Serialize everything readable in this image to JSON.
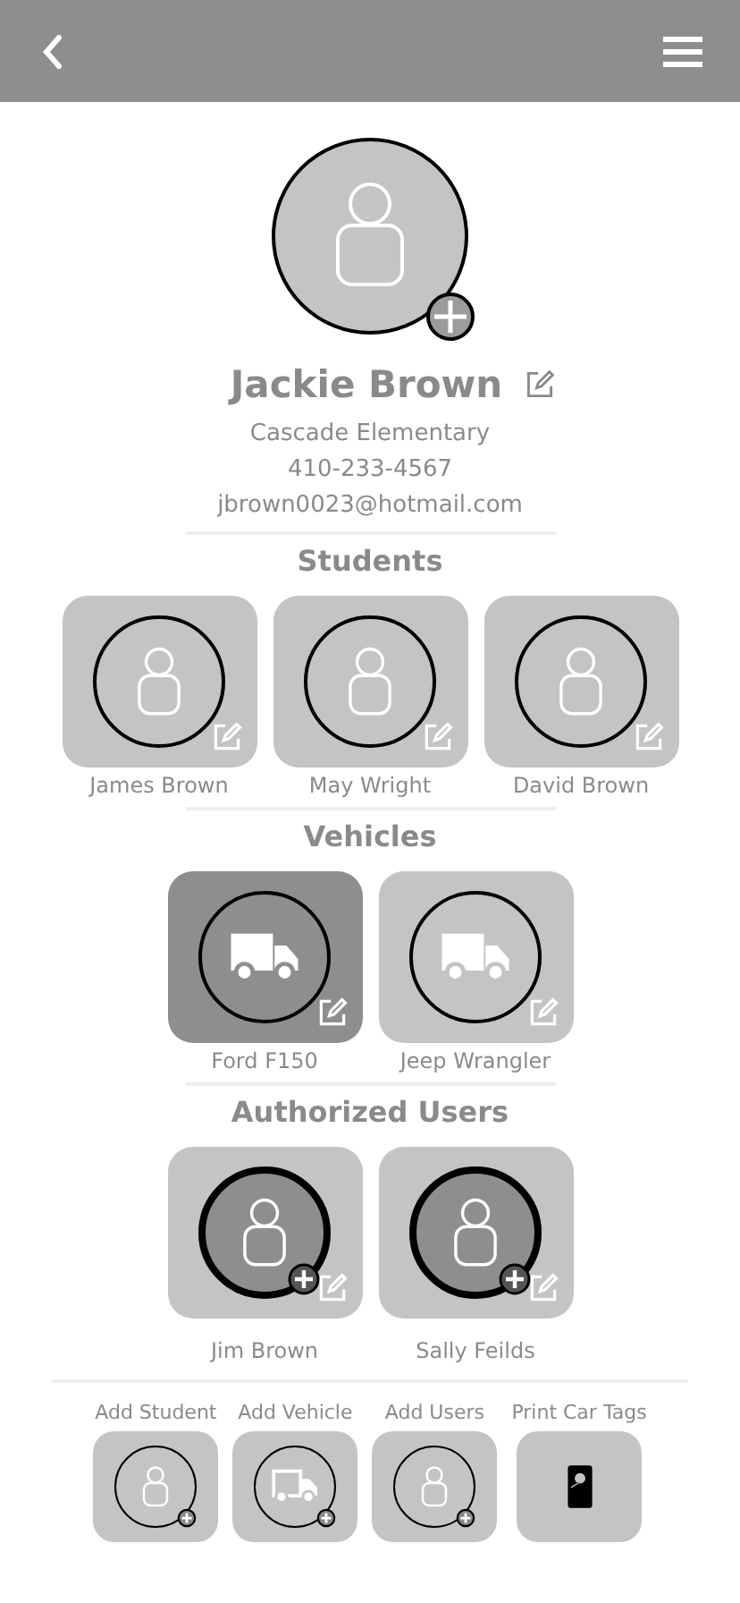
{
  "profile": {
    "name": "Jackie Brown",
    "school": "Cascade Elementary",
    "phone": "410-233-4567",
    "email": "jbrown0023@hotmail.com"
  },
  "students": {
    "title": "Students",
    "items": [
      {
        "name": "James Brown"
      },
      {
        "name": "May Wright"
      },
      {
        "name": "David Brown"
      }
    ]
  },
  "vehicles": {
    "title": "Vehicles",
    "items": [
      {
        "name": "Ford F150",
        "selected": true
      },
      {
        "name": "Jeep Wrangler",
        "selected": false
      }
    ]
  },
  "authorized_users": {
    "title": "Authorized Users",
    "items": [
      {
        "name": "Jim Brown"
      },
      {
        "name": "Sally Feilds"
      }
    ]
  },
  "actions": [
    {
      "label": "Add Student",
      "kind": "student"
    },
    {
      "label": "Add Vehicle",
      "kind": "vehicle"
    },
    {
      "label": "Add Users",
      "kind": "user"
    },
    {
      "label": "Print Car Tags",
      "kind": "tag"
    }
  ]
}
